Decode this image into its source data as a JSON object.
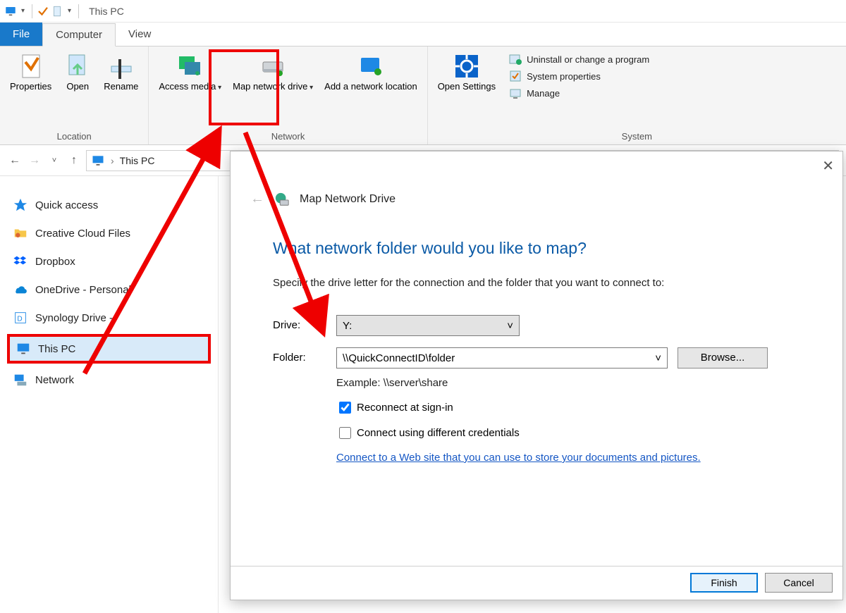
{
  "window": {
    "title": "This PC"
  },
  "ribbon_tabs": {
    "file": "File",
    "computer": "Computer",
    "view": "View"
  },
  "ribbon": {
    "location": {
      "group": "Location",
      "properties": "Properties",
      "open": "Open",
      "rename": "Rename"
    },
    "network": {
      "group": "Network",
      "access_media": "Access media",
      "map_network_drive": "Map network drive",
      "add_network_location": "Add a network location"
    },
    "system": {
      "group": "System",
      "open_settings": "Open Settings",
      "uninstall": "Uninstall or change a program",
      "sys_props": "System properties",
      "manage": "Manage"
    }
  },
  "breadcrumb": {
    "this_pc": "This PC",
    "sep": "›"
  },
  "tree": {
    "quick_access": "Quick access",
    "creative_cloud": "Creative Cloud Files",
    "dropbox": "Dropbox",
    "onedrive": "OneDrive - Personal",
    "synology": "Synology Drive -",
    "this_pc": "This PC",
    "network": "Network"
  },
  "dialog": {
    "title": "Map Network Drive",
    "heading": "What network folder would you like to map?",
    "subtext": "Specify the drive letter for the connection and the folder that you want to connect to:",
    "drive_label": "Drive:",
    "drive_value": "Y:",
    "folder_label": "Folder:",
    "folder_value": "\\\\QuickConnectID\\folder",
    "browse": "Browse...",
    "example": "Example: \\\\server\\share",
    "reconnect": "Reconnect at sign-in",
    "different_creds": "Connect using different credentials",
    "website_link": "Connect to a Web site that you can use to store your documents and pictures",
    "finish": "Finish",
    "cancel": "Cancel"
  }
}
